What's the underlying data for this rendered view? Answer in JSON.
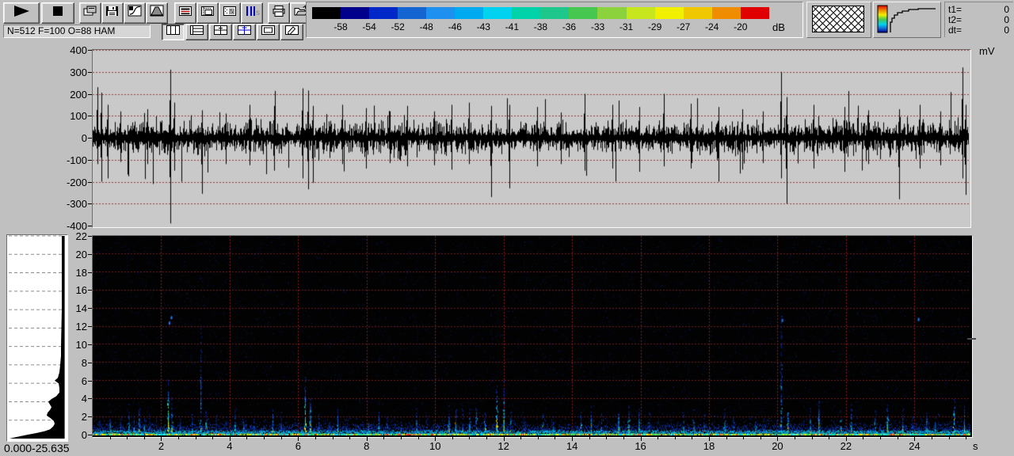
{
  "window": {
    "bg": "#c0c0c0"
  },
  "toolbar": {
    "status_text": "N=512 F=100 O=88 HAM",
    "row1_icons": [
      "play-icon",
      "stop-icon",
      "copy-pages-icon",
      "save-icon",
      "transfer-curve-icon",
      "window-function-icon",
      "display-boxed-icon",
      "display-marks-icon",
      "display-pattern-icon",
      "scale-fs-icon",
      "print-icon",
      "open-file-icon",
      "prev-icon",
      "next-icon"
    ],
    "row2_icons": [
      "layout-columns-icon",
      "layout-rows-icon",
      "layout-grid-icon",
      "layout-grid-alt-icon",
      "layout-frame-icon",
      "edit-notes-icon"
    ],
    "row2_pressed_index": 0
  },
  "colorbar": {
    "unit": "dB",
    "labels": [
      "-58",
      "-54",
      "-52",
      "-48",
      "-46",
      "-43",
      "-41",
      "-38",
      "-36",
      "-33",
      "-31",
      "-29",
      "-27",
      "-24",
      "-20"
    ],
    "colors": [
      "#000000",
      "#00008c",
      "#0028c8",
      "#1464d2",
      "#1e90f0",
      "#00aaf0",
      "#00d2f0",
      "#00d2aa",
      "#1ec88c",
      "#46c850",
      "#8cd23c",
      "#c8e61e",
      "#f0f000",
      "#f0c800",
      "#f08c00",
      "#e10000"
    ]
  },
  "time_readout": {
    "rows": [
      {
        "label": "t1=",
        "value": "0"
      },
      {
        "label": "t2=",
        "value": "0"
      },
      {
        "label": "dt=",
        "value": "0"
      }
    ]
  },
  "chart_data": [
    {
      "type": "line",
      "id": "waveform",
      "unit_label": "mV",
      "ylim": [
        -400,
        400
      ],
      "yticks": [
        400,
        300,
        200,
        100,
        0,
        -100,
        -200,
        -300,
        -400
      ],
      "xlim": [
        0,
        25.635
      ],
      "grid": "horizontal dotted dark-red, every 100 mV",
      "bg": "#c9c9c9",
      "line_color": "#000000",
      "noise_rms_mV": 45,
      "spikes": [
        [
          0.15,
          230,
          -120
        ],
        [
          0.25,
          205,
          -200
        ],
        [
          0.45,
          150,
          -185
        ],
        [
          0.8,
          120,
          -110
        ],
        [
          1.6,
          130,
          -120
        ],
        [
          2.27,
          310,
          -390
        ],
        [
          2.38,
          160,
          -150
        ],
        [
          3.2,
          125,
          -255
        ],
        [
          3.9,
          110,
          -120
        ],
        [
          4.6,
          150,
          -125
        ],
        [
          5.3,
          145,
          -150
        ],
        [
          6.15,
          225,
          -185
        ],
        [
          6.3,
          215,
          -235
        ],
        [
          6.45,
          145,
          -205
        ],
        [
          7.3,
          150,
          -120
        ],
        [
          8.0,
          135,
          -140
        ],
        [
          8.7,
          120,
          -115
        ],
        [
          9.2,
          145,
          -130
        ],
        [
          10.0,
          120,
          -125
        ],
        [
          10.5,
          150,
          -145
        ],
        [
          11.0,
          160,
          -120
        ],
        [
          11.65,
          145,
          -270
        ],
        [
          12.2,
          150,
          -230
        ],
        [
          13.0,
          140,
          -130
        ],
        [
          13.7,
          115,
          -120
        ],
        [
          14.4,
          200,
          -150
        ],
        [
          15.2,
          150,
          -140
        ],
        [
          16.0,
          140,
          -155
        ],
        [
          16.7,
          200,
          -130
        ],
        [
          17.5,
          155,
          -140
        ],
        [
          18.3,
          140,
          -200
        ],
        [
          19.0,
          130,
          -145
        ],
        [
          19.6,
          120,
          -115
        ],
        [
          20.15,
          300,
          -185
        ],
        [
          20.3,
          185,
          -300
        ],
        [
          21.1,
          150,
          -140
        ],
        [
          22.0,
          140,
          -155
        ],
        [
          22.7,
          125,
          -120
        ],
        [
          23.6,
          130,
          -280
        ],
        [
          24.2,
          150,
          -140
        ],
        [
          24.8,
          120,
          -125
        ],
        [
          25.45,
          320,
          -185
        ],
        [
          25.55,
          150,
          -260
        ]
      ]
    },
    {
      "type": "heatmap",
      "id": "spectrogram",
      "unit_label": "s",
      "xlim": [
        0,
        25.635
      ],
      "ylim_kHz": [
        0,
        22
      ],
      "yticks": [
        22,
        20,
        18,
        16,
        14,
        12,
        10,
        8,
        6,
        4,
        2,
        0
      ],
      "xticks": [
        2,
        4,
        6,
        8,
        10,
        12,
        14,
        16,
        18,
        20,
        22,
        24
      ],
      "grid": "dotted dark-red, every 2 units both axes",
      "bg": "#000000",
      "base_band_kHz": 0.5,
      "events": [
        [
          0.2,
          2.2,
          0.4
        ],
        [
          0.5,
          2.6,
          0.5
        ],
        [
          0.8,
          2.1,
          0.4
        ],
        [
          1.05,
          3.4,
          0.6
        ],
        [
          1.2,
          2.9,
          0.6
        ],
        [
          1.35,
          3.2,
          0.6
        ],
        [
          1.5,
          2.6,
          0.5
        ],
        [
          1.65,
          2.2,
          0.4
        ],
        [
          1.85,
          2.0,
          0.4
        ],
        [
          2.2,
          6.3,
          0.9
        ],
        [
          2.3,
          4.2,
          0.7
        ],
        [
          2.55,
          2.2,
          0.4
        ],
        [
          2.9,
          2.6,
          0.5
        ],
        [
          3.15,
          12.0,
          0.5
        ],
        [
          3.3,
          3.0,
          0.6
        ],
        [
          3.6,
          2.2,
          0.4
        ],
        [
          3.9,
          2.0,
          0.4
        ],
        [
          4.15,
          3.0,
          0.6
        ],
        [
          4.4,
          2.6,
          0.5
        ],
        [
          4.7,
          2.1,
          0.4
        ],
        [
          5.0,
          2.0,
          0.4
        ],
        [
          5.25,
          3.4,
          0.6
        ],
        [
          5.5,
          2.6,
          0.5
        ],
        [
          5.8,
          2.1,
          0.4
        ],
        [
          6.2,
          6.5,
          0.8
        ],
        [
          6.35,
          5.0,
          0.7
        ],
        [
          6.6,
          2.4,
          0.5
        ],
        [
          6.9,
          2.0,
          0.4
        ],
        [
          7.15,
          3.0,
          0.6
        ],
        [
          7.4,
          2.6,
          0.5
        ],
        [
          7.7,
          2.1,
          0.4
        ],
        [
          8.05,
          2.4,
          0.5
        ],
        [
          8.35,
          3.0,
          0.6
        ],
        [
          8.6,
          2.4,
          0.5
        ],
        [
          9.0,
          2.1,
          0.4
        ],
        [
          9.45,
          2.9,
          0.6
        ],
        [
          9.75,
          2.2,
          0.4
        ],
        [
          10.4,
          3.3,
          0.7
        ],
        [
          10.6,
          2.9,
          0.7
        ],
        [
          10.8,
          3.1,
          0.7
        ],
        [
          11.0,
          2.9,
          0.7
        ],
        [
          11.2,
          3.3,
          0.7
        ],
        [
          11.45,
          3.0,
          0.7
        ],
        [
          11.8,
          5.6,
          0.8
        ],
        [
          12.0,
          6.0,
          0.7
        ],
        [
          12.2,
          3.0,
          0.6
        ],
        [
          12.6,
          2.1,
          0.4
        ],
        [
          13.15,
          2.9,
          0.6
        ],
        [
          13.45,
          2.5,
          0.5
        ],
        [
          14.25,
          2.9,
          0.6
        ],
        [
          14.55,
          3.3,
          0.6
        ],
        [
          14.85,
          2.5,
          0.5
        ],
        [
          15.35,
          3.0,
          0.7
        ],
        [
          15.65,
          3.4,
          0.7
        ],
        [
          15.95,
          3.0,
          0.7
        ],
        [
          16.25,
          2.6,
          0.5
        ],
        [
          17.25,
          2.9,
          0.6
        ],
        [
          17.55,
          3.3,
          0.6
        ],
        [
          17.85,
          2.5,
          0.5
        ],
        [
          18.45,
          2.9,
          0.6
        ],
        [
          18.7,
          2.5,
          0.5
        ],
        [
          19.35,
          2.6,
          0.5
        ],
        [
          19.6,
          2.2,
          0.4
        ],
        [
          20.1,
          13.6,
          0.5
        ],
        [
          20.3,
          4.0,
          0.7
        ],
        [
          20.95,
          2.9,
          0.6
        ],
        [
          21.2,
          3.9,
          0.7
        ],
        [
          21.85,
          2.9,
          0.6
        ],
        [
          22.15,
          3.4,
          0.6
        ],
        [
          22.85,
          2.9,
          0.6
        ],
        [
          23.2,
          3.9,
          0.7
        ],
        [
          23.65,
          3.0,
          0.6
        ],
        [
          23.95,
          2.5,
          0.5
        ],
        [
          24.35,
          2.9,
          0.6
        ],
        [
          24.6,
          2.4,
          0.5
        ],
        [
          25.15,
          4.4,
          0.7
        ],
        [
          25.45,
          3.4,
          0.6
        ]
      ],
      "high_dots": [
        [
          2.22,
          12.3
        ],
        [
          2.28,
          12.9
        ],
        [
          20.12,
          12.6
        ],
        [
          24.1,
          12.7
        ]
      ]
    },
    {
      "type": "area",
      "id": "average-spectrum-profile",
      "range_label": "0.000-25.635",
      "orientation": "vertical, amplitude grows leftward from right edge",
      "points": [
        [
          22,
          2
        ],
        [
          18,
          2
        ],
        [
          14,
          2
        ],
        [
          12,
          2.5
        ],
        [
          10,
          3
        ],
        [
          9,
          3
        ],
        [
          8,
          4
        ],
        [
          7.2,
          5
        ],
        [
          6.6,
          7
        ],
        [
          6.3,
          11
        ],
        [
          6,
          6
        ],
        [
          5.5,
          5
        ],
        [
          5,
          5
        ],
        [
          4.6,
          9
        ],
        [
          4.3,
          15
        ],
        [
          4,
          19
        ],
        [
          3.7,
          17
        ],
        [
          3.4,
          15
        ],
        [
          3.1,
          17
        ],
        [
          2.8,
          20
        ],
        [
          2.5,
          21
        ],
        [
          2.2,
          16
        ],
        [
          1.9,
          12
        ],
        [
          1.6,
          11
        ],
        [
          1.3,
          13
        ],
        [
          1,
          17
        ],
        [
          0.8,
          24
        ],
        [
          0.6,
          34
        ],
        [
          0.4,
          46
        ],
        [
          0.25,
          55
        ],
        [
          0.12,
          62
        ],
        [
          0,
          68
        ]
      ]
    }
  ]
}
